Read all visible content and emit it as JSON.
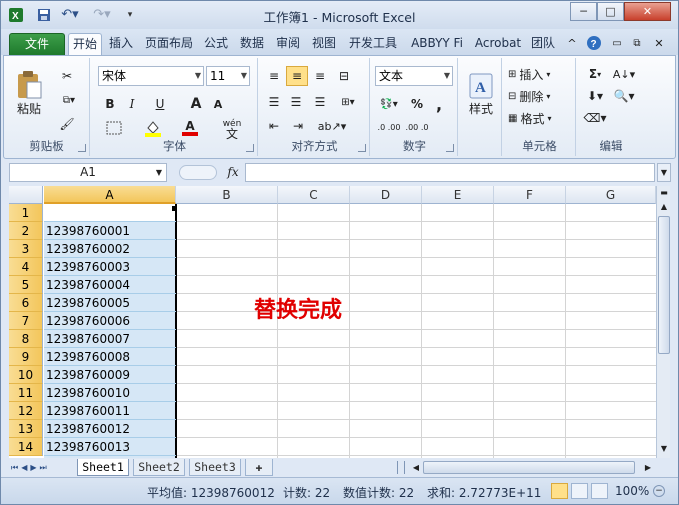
{
  "title": "工作簿1  -  Microsoft Excel",
  "window_controls": {
    "minimize": "─",
    "maximize": "□",
    "close": "✕"
  },
  "tabs": [
    "文件",
    "开始",
    "插入",
    "页面布局",
    "公式",
    "数据",
    "审阅",
    "视图",
    "开发工具",
    "ABBYY Fi",
    "Acrobat",
    "团队"
  ],
  "ribbon": {
    "clipboard": {
      "label": "剪贴板",
      "paste": "粘贴"
    },
    "font": {
      "label": "字体",
      "name": "宋体",
      "size": "11",
      "bold": "B",
      "italic": "I",
      "underline": "U",
      "grow": "A",
      "shrink": "A",
      "font_color": "A",
      "phonetic": "wén"
    },
    "alignment": {
      "label": "对齐方式"
    },
    "number": {
      "label": "数字",
      "format": "文本",
      "percent": "%",
      "comma": ",",
      "inc_dec": ".0 .00",
      "dec_dec": ".00 .0"
    },
    "styles": {
      "label": "样式"
    },
    "cells": {
      "label": "单元格",
      "insert": "插入",
      "delete": "删除",
      "format": "格式"
    },
    "editing": {
      "label": "编辑",
      "sum": "Σ"
    }
  },
  "name_box": "A1",
  "fx": "fx",
  "columns": [
    "A",
    "B",
    "C",
    "D",
    "E",
    "F",
    "G"
  ],
  "rows": [
    {
      "n": "1",
      "a": ""
    },
    {
      "n": "2",
      "a": "12398760001"
    },
    {
      "n": "3",
      "a": "12398760002"
    },
    {
      "n": "4",
      "a": "12398760003"
    },
    {
      "n": "5",
      "a": "12398760004"
    },
    {
      "n": "6",
      "a": "12398760005"
    },
    {
      "n": "7",
      "a": "12398760006"
    },
    {
      "n": "8",
      "a": "12398760007"
    },
    {
      "n": "9",
      "a": "12398760008"
    },
    {
      "n": "10",
      "a": "12398760009"
    },
    {
      "n": "11",
      "a": "12398760010"
    },
    {
      "n": "12",
      "a": "12398760011"
    },
    {
      "n": "13",
      "a": "12398760012"
    },
    {
      "n": "14",
      "a": "12398760013"
    }
  ],
  "annotation": "替换完成",
  "sheets": [
    "Sheet1",
    "Sheet2",
    "Sheet3"
  ],
  "status": {
    "average": "平均值: 12398760012",
    "count": "计数: 22",
    "numeric_count": "数值计数: 22",
    "sum": "求和: 2.72773E+11",
    "zoom": "100%"
  },
  "colors": {
    "accent": "#1e7a2c",
    "selection": "#f3c65b",
    "annotation": "#e00000"
  }
}
